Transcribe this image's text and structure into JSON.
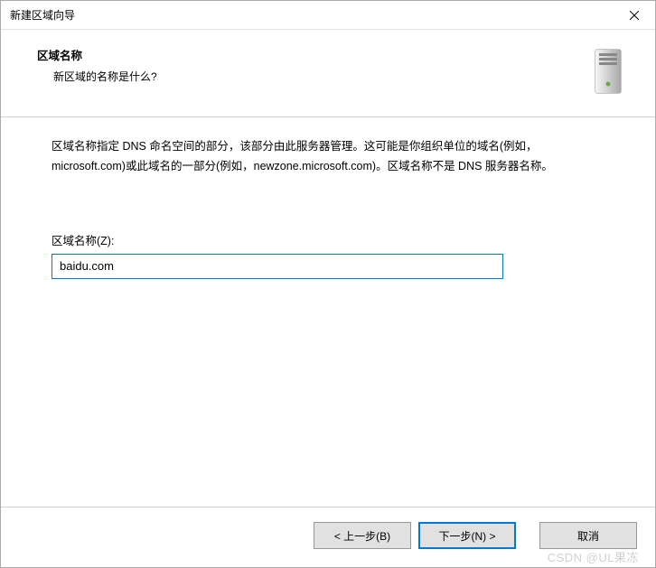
{
  "window": {
    "title": "新建区域向导"
  },
  "header": {
    "title": "区域名称",
    "subtitle": "新区域的名称是什么?"
  },
  "content": {
    "description": "区域名称指定 DNS 命名空间的部分，该部分由此服务器管理。这可能是你组织单位的域名(例如，microsoft.com)或此域名的一部分(例如，newzone.microsoft.com)。区域名称不是 DNS 服务器名称。",
    "input_label": "区域名称(Z):",
    "input_value": "baidu.com"
  },
  "footer": {
    "back": "< 上一步(B)",
    "next": "下一步(N) >",
    "cancel": "取消"
  },
  "watermark": "CSDN @UL果冻"
}
